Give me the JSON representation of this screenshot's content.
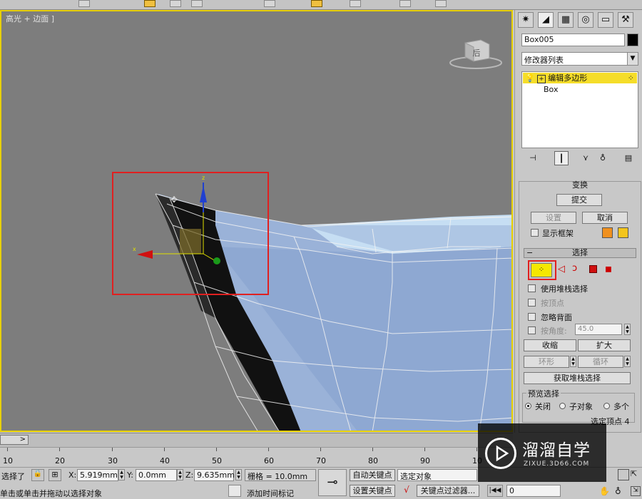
{
  "viewport": {
    "label": "高光 + 边面 ]",
    "viewcube_label": "后"
  },
  "panel": {
    "tabs": [
      "create-icon",
      "modify-icon",
      "hierarchy-icon",
      "motion-icon",
      "display-icon",
      "utilities-icon"
    ],
    "object_name": "Box005",
    "modifier_list": "修改器列表",
    "stack_items": [
      "编辑多边形",
      "Box"
    ],
    "transform_header": "变换",
    "commit_label": "提交",
    "settings_label": "设置",
    "cancel_label": "取消",
    "show_cage_label": "显示框架",
    "cage_colors": [
      "#f0901e",
      "#f3c51d"
    ],
    "selection_header": "选择",
    "use_stack_label": "使用堆栈选择",
    "by_vertex_label": "按顶点",
    "ignore_backface_label": "忽略背面",
    "by_angle_label": "按角度:",
    "by_angle_value": "45.0",
    "shrink_label": "收缩",
    "grow_label": "扩大",
    "ring_label": "环形",
    "loop_label": "循环",
    "get_stack_sel_label": "获取堆栈选择",
    "preview_sel_label": "预览选择",
    "preview_off": "关闭",
    "preview_subobj": "子对象",
    "preview_multi": "多个",
    "selected_info": "选定顶点 4"
  },
  "timeline": {
    "slider_glyph": ">",
    "ticks": [
      "10",
      "20",
      "30",
      "40",
      "50",
      "60",
      "70",
      "80",
      "90",
      "10"
    ]
  },
  "status": {
    "selected_label": "选择了",
    "x_label": "X:",
    "x_value": "5.919mm",
    "y_label": "Y:",
    "y_value": "0.0mm",
    "z_label": "Z:",
    "z_value": "9.635mm",
    "grid_label": "栅格 = 10.0mm",
    "auto_key_label": "自动关键点",
    "set_key_label": "设置关键点",
    "selected_object": "选定对象",
    "key_filters": "关键点过滤器...",
    "frame_value": "0",
    "prompt": "单击或单击并拖动以选择对象",
    "add_time_tag": "添加时间标记"
  },
  "watermark": {
    "title": "溜溜自学",
    "url": "ZIXUE.3D66.COM"
  },
  "colors": {
    "highlight_yellow": "#f5dd2a",
    "selection_red": "#e02020",
    "viewport_bg": "#7d7d7d",
    "mesh_blue": "#9ab2d8"
  }
}
